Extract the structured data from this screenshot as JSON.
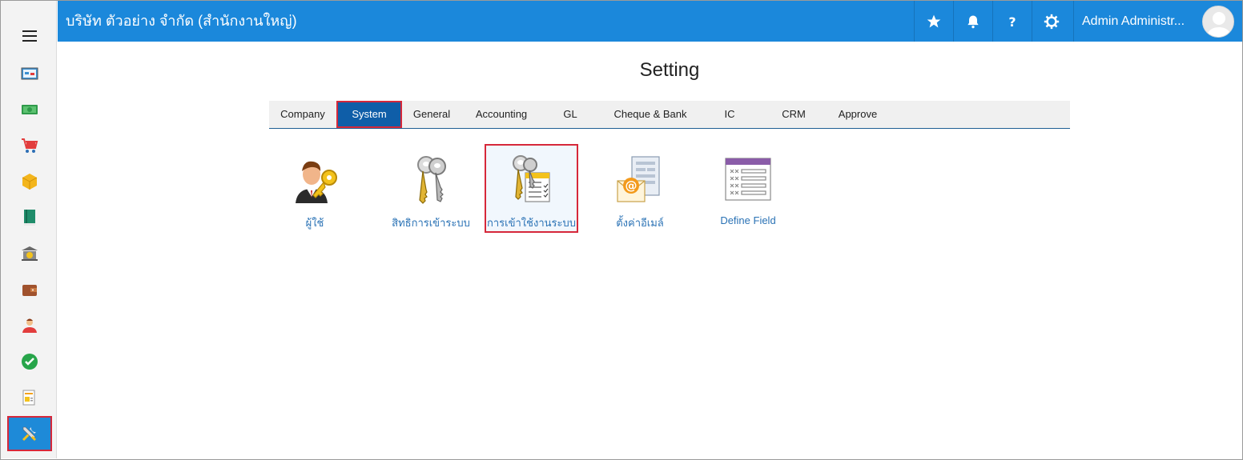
{
  "header": {
    "company": "บริษัท ตัวอย่าง จำกัด (สำนักงานใหญ่)",
    "user_name": "Admin Administr...",
    "icons": [
      "star-icon",
      "bell-icon",
      "help-icon",
      "gear-icon"
    ]
  },
  "sidebar": {
    "menu_icon": "hamburger-icon",
    "items": [
      {
        "icon": "dashboard-icon"
      },
      {
        "icon": "money-icon"
      },
      {
        "icon": "cart-icon"
      },
      {
        "icon": "box-icon"
      },
      {
        "icon": "book-icon"
      },
      {
        "icon": "bank-icon"
      },
      {
        "icon": "wallet-icon"
      },
      {
        "icon": "person-icon"
      },
      {
        "icon": "check-icon"
      },
      {
        "icon": "report-icon"
      },
      {
        "icon": "tools-icon",
        "active": true
      }
    ]
  },
  "main": {
    "title": "Setting",
    "tabs": [
      {
        "label": "Company"
      },
      {
        "label": "System",
        "active": true
      },
      {
        "label": "General"
      },
      {
        "label": "Accounting"
      },
      {
        "label": "GL"
      },
      {
        "label": "Cheque & Bank"
      },
      {
        "label": "IC"
      },
      {
        "label": "CRM"
      },
      {
        "label": "Approve"
      }
    ],
    "tiles": [
      {
        "label": "ผู้ใช้",
        "icon": "user-key-icon"
      },
      {
        "label": "สิทธิการเข้าระบบ",
        "icon": "keys-icon"
      },
      {
        "label": "การเข้าใช้งานระบบ",
        "icon": "keys-list-icon",
        "selected": true
      },
      {
        "label": "ตั้งค่าอีเมล์",
        "icon": "email-settings-icon"
      },
      {
        "label": "Define Field",
        "icon": "define-field-icon"
      }
    ]
  },
  "colors": {
    "header_bg": "#1b88db",
    "active_tab_bg": "#0f5ea8",
    "highlight_border": "#d6283a",
    "tile_label": "#2a72b5"
  }
}
